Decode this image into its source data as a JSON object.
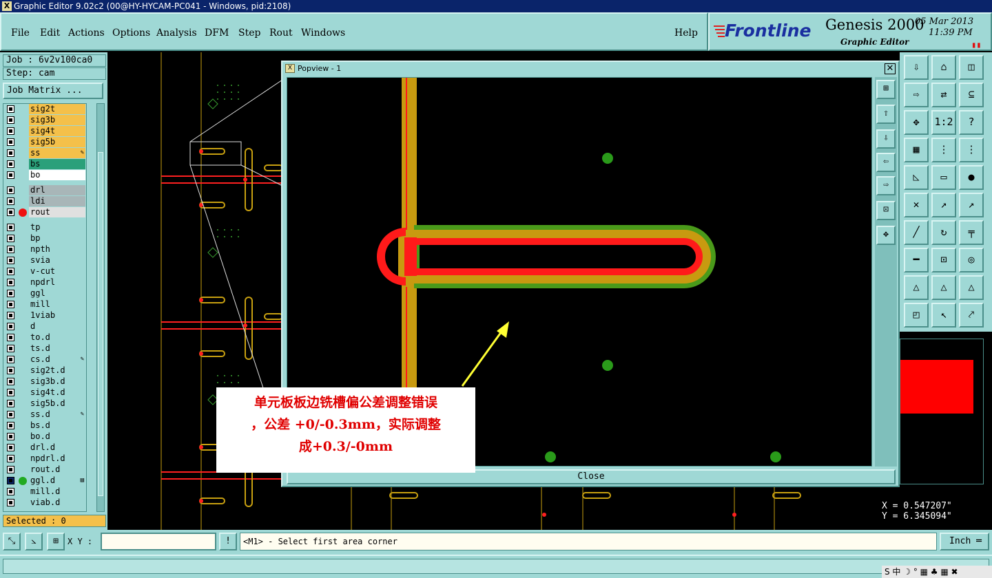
{
  "window": {
    "title": "Graphic Editor 9.02c2 (00@HY-HYCAM-PC041 - Windows, pid:2108)"
  },
  "menu": {
    "items": [
      {
        "label": "File"
      },
      {
        "label": "Edit"
      },
      {
        "label": "Actions"
      },
      {
        "label": "Options"
      },
      {
        "label": "Analysis"
      },
      {
        "label": "DFM"
      },
      {
        "label": "Step"
      },
      {
        "label": "Rout"
      },
      {
        "label": "Windows"
      }
    ],
    "help": "Help"
  },
  "brand": {
    "logo": "Frontline",
    "product": "Genesis 2000",
    "subtitle": "Graphic Editor",
    "date": "05 Mar 2013",
    "time": "11:39 PM",
    "pause": "▮▮"
  },
  "job": {
    "job_label": "Job : 6v2v100ca0",
    "step_label": "Step: cam",
    "matrix_button": "Job Matrix ..."
  },
  "layers": [
    {
      "name": "sig2t",
      "bg": "#f4c04a"
    },
    {
      "name": "sig3b",
      "bg": "#f4c04a"
    },
    {
      "name": "sig4t",
      "bg": "#f4c04a"
    },
    {
      "name": "sig5b",
      "bg": "#f4c04a"
    },
    {
      "name": "ss",
      "bg": "#f4c04a",
      "mark": "✎"
    },
    {
      "name": "bs",
      "bg": "#2aa07a"
    },
    {
      "name": "bo",
      "bg": "#ffffff"
    },
    {
      "name": "drl",
      "bg": "#a8b6b8",
      "gap": true
    },
    {
      "name": "ldi",
      "bg": "#a8b6b8"
    },
    {
      "name": "rout",
      "bg": "#e0e0e0",
      "dot": "#ee1111"
    },
    {
      "name": "tp",
      "bg": "#9fd8d5",
      "gap": true
    },
    {
      "name": "bp",
      "bg": "#9fd8d5"
    },
    {
      "name": "npth",
      "bg": "#9fd8d5"
    },
    {
      "name": "svia",
      "bg": "#9fd8d5"
    },
    {
      "name": "v-cut",
      "bg": "#9fd8d5"
    },
    {
      "name": "npdrl",
      "bg": "#9fd8d5"
    },
    {
      "name": "ggl",
      "bg": "#9fd8d5"
    },
    {
      "name": "mill",
      "bg": "#9fd8d5"
    },
    {
      "name": "1viab",
      "bg": "#9fd8d5"
    },
    {
      "name": "d",
      "bg": "#9fd8d5"
    },
    {
      "name": "to.d",
      "bg": "#9fd8d5"
    },
    {
      "name": "ts.d",
      "bg": "#9fd8d5"
    },
    {
      "name": "cs.d",
      "bg": "#9fd8d5",
      "mark": "✎"
    },
    {
      "name": "sig2t.d",
      "bg": "#9fd8d5"
    },
    {
      "name": "sig3b.d",
      "bg": "#9fd8d5"
    },
    {
      "name": "sig4t.d",
      "bg": "#9fd8d5"
    },
    {
      "name": "sig5b.d",
      "bg": "#9fd8d5"
    },
    {
      "name": "ss.d",
      "bg": "#9fd8d5",
      "mark": "✎"
    },
    {
      "name": "bs.d",
      "bg": "#9fd8d5"
    },
    {
      "name": "bo.d",
      "bg": "#9fd8d5"
    },
    {
      "name": "drl.d",
      "bg": "#9fd8d5"
    },
    {
      "name": "npdrl.d",
      "bg": "#9fd8d5"
    },
    {
      "name": "rout.d",
      "bg": "#9fd8d5"
    },
    {
      "name": "ggl.d",
      "bg": "#9fd8d5",
      "dot": "#22aa22",
      "mark": "▤",
      "active": true
    },
    {
      "name": "mill.d",
      "bg": "#9fd8d5"
    },
    {
      "name": "viab.d",
      "bg": "#9fd8d5"
    }
  ],
  "selected": "Selected : 0",
  "popview": {
    "title": "Popview - 1",
    "close_label": "Close"
  },
  "annotation": {
    "line1": "单元板板边铣槽偏公差调整错误",
    "line2": "，公差 +0/-0.3mm，实际调整",
    "line3": "成+0.3/-0mm"
  },
  "coords": {
    "x": "X = 0.547207\"",
    "y": "Y = 6.345094\""
  },
  "bottom": {
    "xy_label": "X Y :",
    "xy_value": "",
    "prompt": "<M1> - Select first area corner",
    "units": "Inch ═"
  },
  "tray": "S 中 ☽ ° ▦ ♣ ▦ ✖",
  "colors": {
    "panel": "#9fd8d5",
    "trace_orange": "#c89a10",
    "trace_red": "#ff1a1a",
    "outline_green": "#4a9a1a"
  }
}
